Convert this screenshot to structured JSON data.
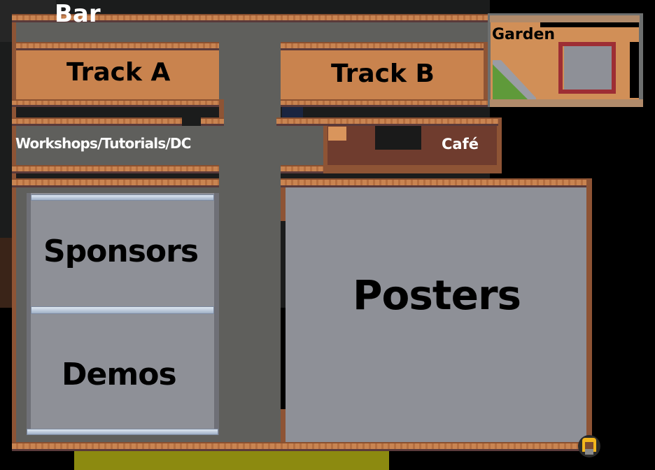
{
  "map": {
    "rooms": {
      "bar": "Bar",
      "track_a": "Track A",
      "track_b": "Track B",
      "garden": "Garden",
      "workshops": "Workshops/Tutorials/DC",
      "cafe": "Café",
      "sponsors": "Sponsors",
      "demos": "Demos",
      "posters": "Posters"
    },
    "player": {
      "icon": "player-avatar-icon"
    }
  },
  "colors": {
    "wall": "#8e5435",
    "floor_orange": "#c9834e",
    "corridor": "#5f5f5c",
    "room_grey": "#8e9097",
    "cafe": "#6f3c2e",
    "garden": "#d18f57"
  }
}
